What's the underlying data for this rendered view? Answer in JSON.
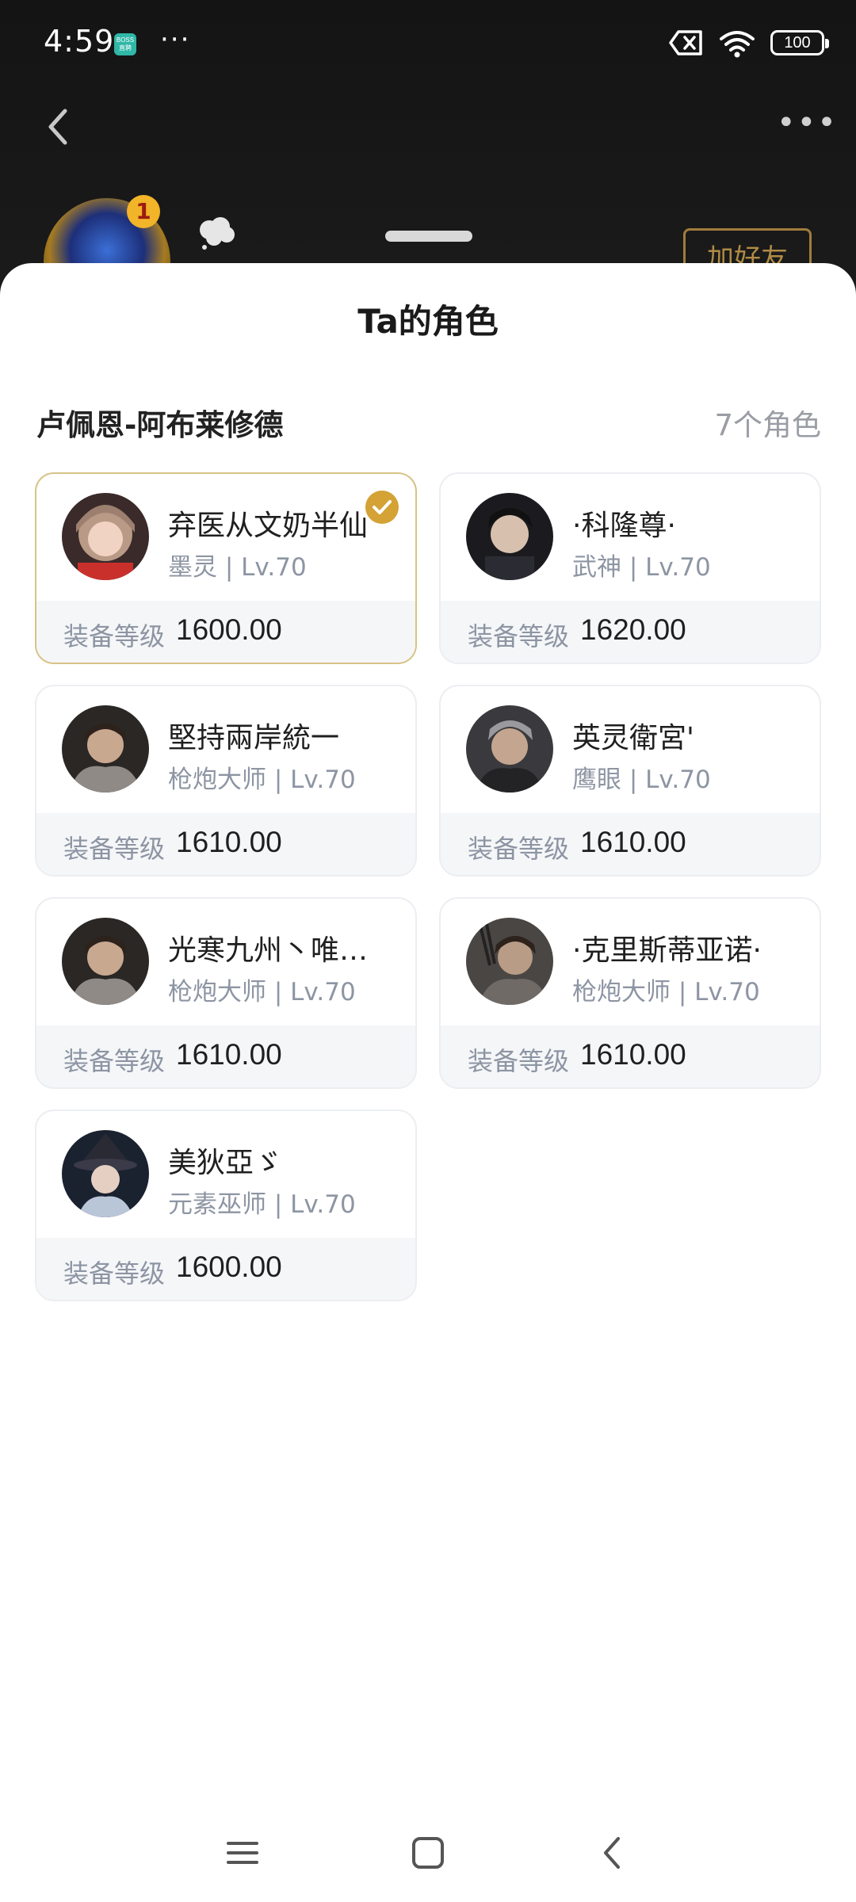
{
  "status_bar": {
    "time": "4:59",
    "app_icon_label": "BOSS直聘",
    "more_dots": "···",
    "battery": "100"
  },
  "header": {
    "more_dots": "•••",
    "add_friend_label": "加好友",
    "profile_badge": "1"
  },
  "sheet": {
    "title": "Ta的角色",
    "server": "卢佩恩-阿布莱修德",
    "count": "7个角色"
  },
  "characters": [
    {
      "name": "弃医从文奶半仙",
      "class_line": "墨灵 | Lv.70",
      "gear_label": "装备等级",
      "gear_level": "1600.00",
      "selected": true
    },
    {
      "name": "·科隆尊·",
      "class_line": "武神 | Lv.70",
      "gear_label": "装备等级",
      "gear_level": "1620.00",
      "selected": false
    },
    {
      "name": "堅持兩岸統一",
      "class_line": "枪炮大师 | Lv.70",
      "gear_label": "装备等级",
      "gear_level": "1610.00",
      "selected": false
    },
    {
      "name": "英灵衛宮'",
      "class_line": "鹰眼 | Lv.70",
      "gear_label": "装备等级",
      "gear_level": "1610.00",
      "selected": false
    },
    {
      "name": "光寒九州丶唯…",
      "class_line": "枪炮大师 | Lv.70",
      "gear_label": "装备等级",
      "gear_level": "1610.00",
      "selected": false
    },
    {
      "name": "·克里斯蒂亚诺·",
      "class_line": "枪炮大师 | Lv.70",
      "gear_label": "装备等级",
      "gear_level": "1610.00",
      "selected": false
    },
    {
      "name": "美狄亞ゞ",
      "class_line": "元素巫师 | Lv.70",
      "gear_label": "装备等级",
      "gear_level": "1600.00",
      "selected": false
    }
  ],
  "icons": {
    "back": "chevron-left-icon",
    "more": "more-horizontal-icon",
    "selected": "check-circle-icon",
    "nav_menu": "menu-icon",
    "nav_home": "home-square-icon",
    "nav_back": "back-icon"
  },
  "colors": {
    "accent_gold": "#d4a235",
    "muted_text": "#8d95a3",
    "card_footer": "#f5f6f8"
  }
}
